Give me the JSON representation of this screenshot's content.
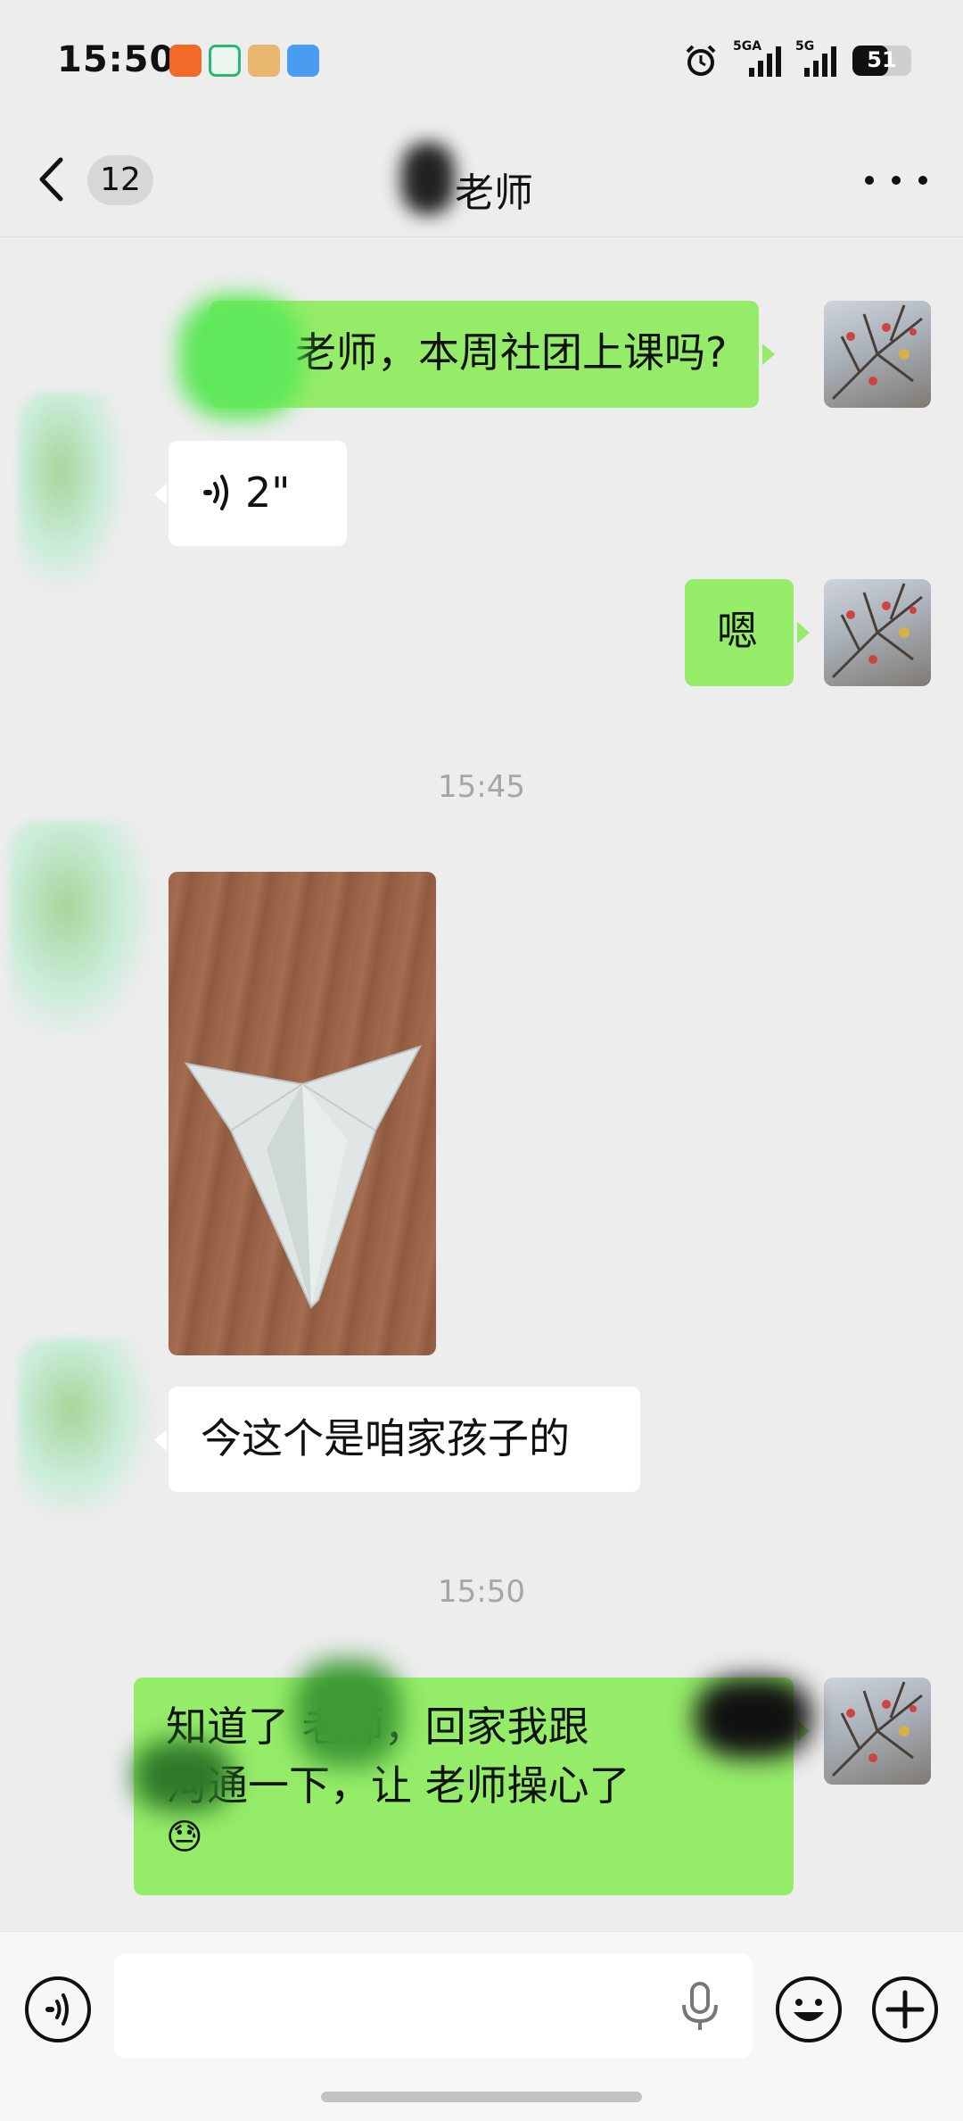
{
  "status_bar": {
    "time": "15:50",
    "signal1_label": "5GA",
    "signal2_label": "5G",
    "battery": "51",
    "icons": [
      "sogou-app-icon",
      "green-app-icon",
      "game-app-icon",
      "weather-app-icon",
      "alarm-icon"
    ]
  },
  "nav": {
    "unread_count": "12",
    "title": "老师"
  },
  "messages": [
    {
      "sender": "self",
      "type": "text",
      "text": "老师，本周社团上课吗?"
    },
    {
      "sender": "other",
      "type": "voice",
      "duration": "2\""
    },
    {
      "sender": "self",
      "type": "text",
      "text": "嗯"
    },
    {
      "type": "time",
      "text": "15:45"
    },
    {
      "sender": "other",
      "type": "image",
      "description": "paper-airplane-photo"
    },
    {
      "sender": "other",
      "type": "text",
      "text": "今这个是咱家孩子的"
    },
    {
      "type": "time",
      "text": "15:50"
    },
    {
      "sender": "self",
      "type": "text",
      "line1": "知道了 老师，回家我跟",
      "line2": "沟通一下，让 老师操心了",
      "emoji": "😓"
    }
  ],
  "input": {
    "value": "",
    "placeholder": ""
  }
}
